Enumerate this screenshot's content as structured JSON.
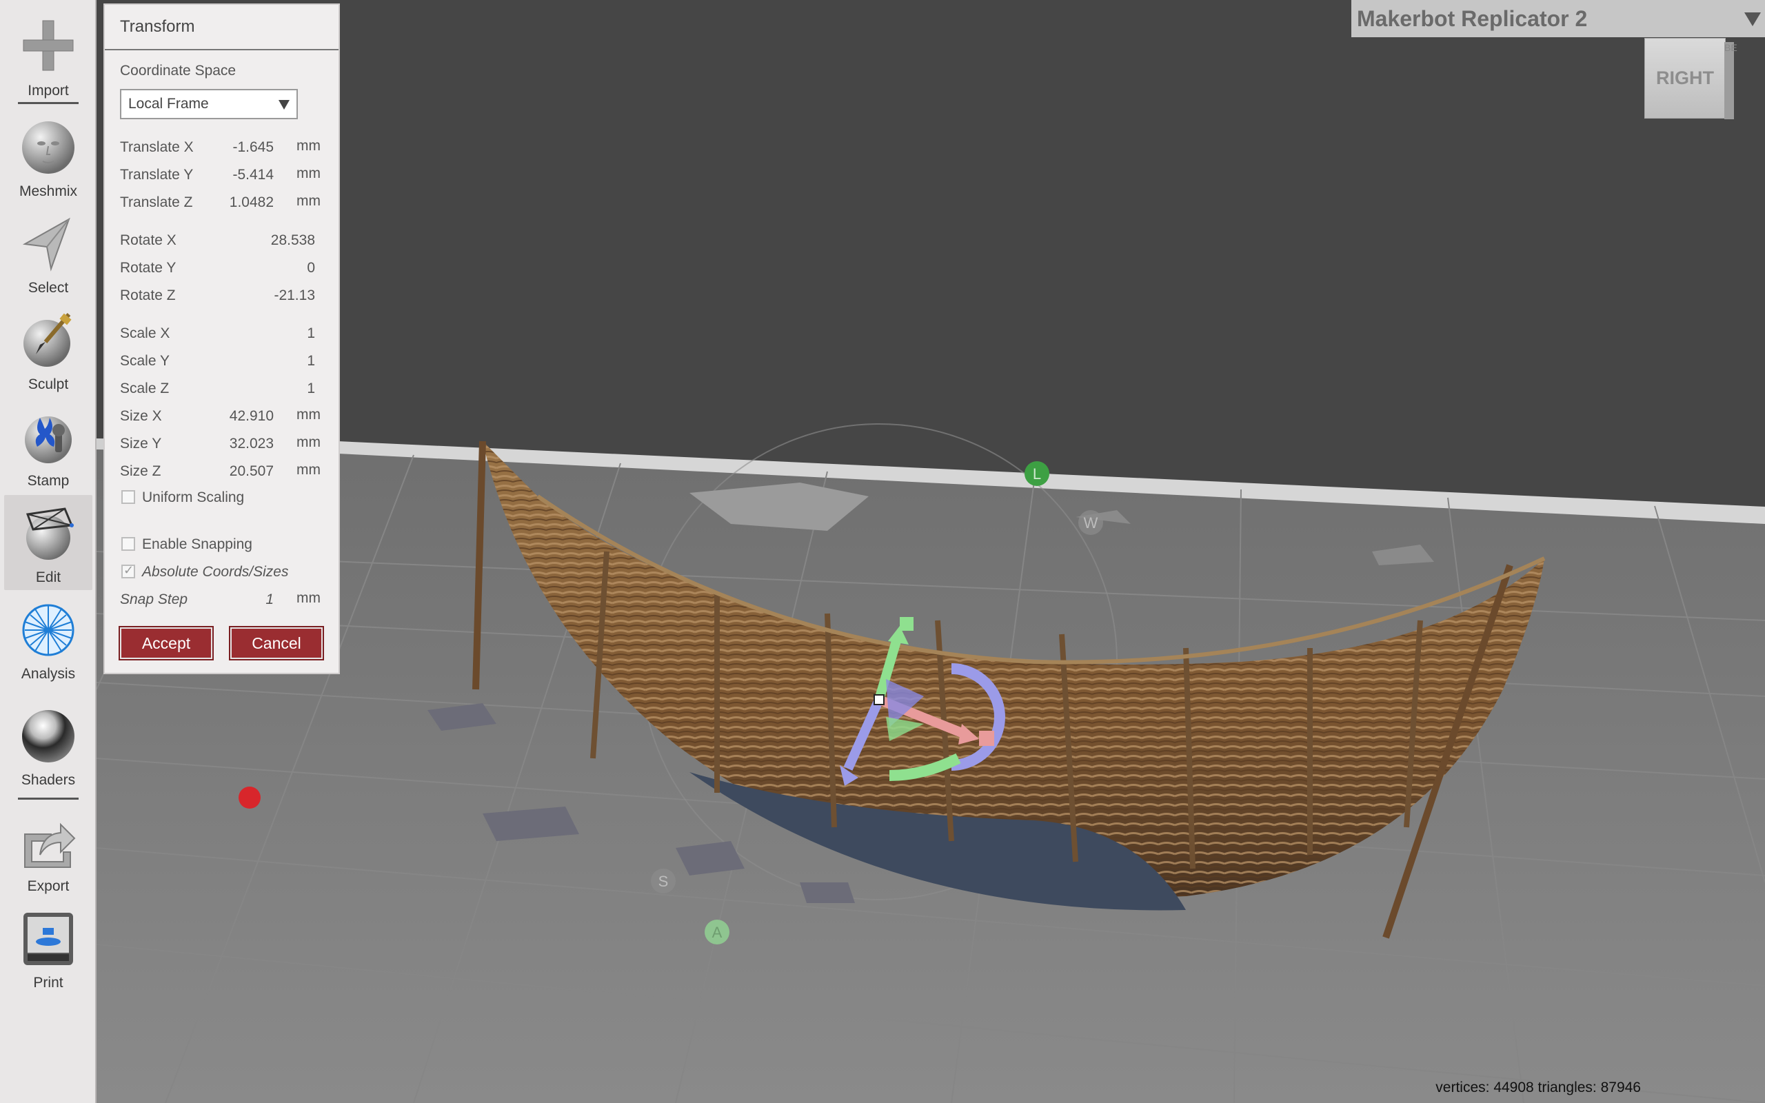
{
  "toolbar": {
    "items": [
      {
        "id": "import",
        "label": "Import",
        "icon": "plus-icon"
      },
      {
        "id": "meshmix",
        "label": "Meshmix",
        "icon": "face-sphere-icon"
      },
      {
        "id": "select",
        "label": "Select",
        "icon": "cursor-arrow-icon"
      },
      {
        "id": "sculpt",
        "label": "Sculpt",
        "icon": "brush-sphere-icon"
      },
      {
        "id": "stamp",
        "label": "Stamp",
        "icon": "stamp-icon"
      },
      {
        "id": "edit",
        "label": "Edit",
        "icon": "edit-sphere-icon",
        "active": true
      },
      {
        "id": "analysis",
        "label": "Analysis",
        "icon": "analysis-mesh-icon"
      },
      {
        "id": "shaders",
        "label": "Shaders",
        "icon": "chrome-sphere-icon"
      },
      {
        "id": "export",
        "label": "Export",
        "icon": "export-icon"
      },
      {
        "id": "print",
        "label": "Print",
        "icon": "printer-icon"
      }
    ]
  },
  "transform": {
    "title": "Transform",
    "coord_space_label": "Coordinate Space",
    "coord_space_value": "Local Frame",
    "translate_x": {
      "label": "Translate X",
      "value": "-1.645",
      "unit": "mm"
    },
    "translate_y": {
      "label": "Translate Y",
      "value": "-5.414",
      "unit": "mm"
    },
    "translate_z": {
      "label": "Translate Z",
      "value": "1.0482",
      "unit": "mm"
    },
    "rotate_x": {
      "label": "Rotate X",
      "value": "28.538"
    },
    "rotate_y": {
      "label": "Rotate Y",
      "value": "0"
    },
    "rotate_z": {
      "label": "Rotate Z",
      "value": "-21.13"
    },
    "scale_x": {
      "label": "Scale X",
      "value": "1"
    },
    "scale_y": {
      "label": "Scale Y",
      "value": "1"
    },
    "scale_z": {
      "label": "Scale Z",
      "value": "1"
    },
    "size_x": {
      "label": "Size X",
      "value": "42.910",
      "unit": "mm"
    },
    "size_y": {
      "label": "Size Y",
      "value": "32.023",
      "unit": "mm"
    },
    "size_z": {
      "label": "Size Z",
      "value": "20.507",
      "unit": "mm"
    },
    "uniform_scaling": {
      "label": "Uniform Scaling",
      "checked": false
    },
    "enable_snapping": {
      "label": "Enable Snapping",
      "checked": false
    },
    "absolute_coords": {
      "label": "Absolute Coords/Sizes",
      "checked": true
    },
    "snap_step": {
      "label": "Snap Step",
      "value": "1",
      "unit": "mm"
    },
    "accept_label": "Accept",
    "cancel_label": "Cancel"
  },
  "printer": {
    "name": "Makerbot Replicator 2"
  },
  "view_cube": {
    "face": "RIGHT",
    "side": "BE"
  },
  "gizmo_markers": {
    "w": "W",
    "s": "S",
    "a": "A",
    "l": "L"
  },
  "status": "vertices: 44908 triangles: 87946",
  "colors": {
    "viewport_bg": "#464646",
    "floor": "#6e6e6e",
    "accept_bg": "#9a2d31",
    "wood": "#8a6238"
  }
}
